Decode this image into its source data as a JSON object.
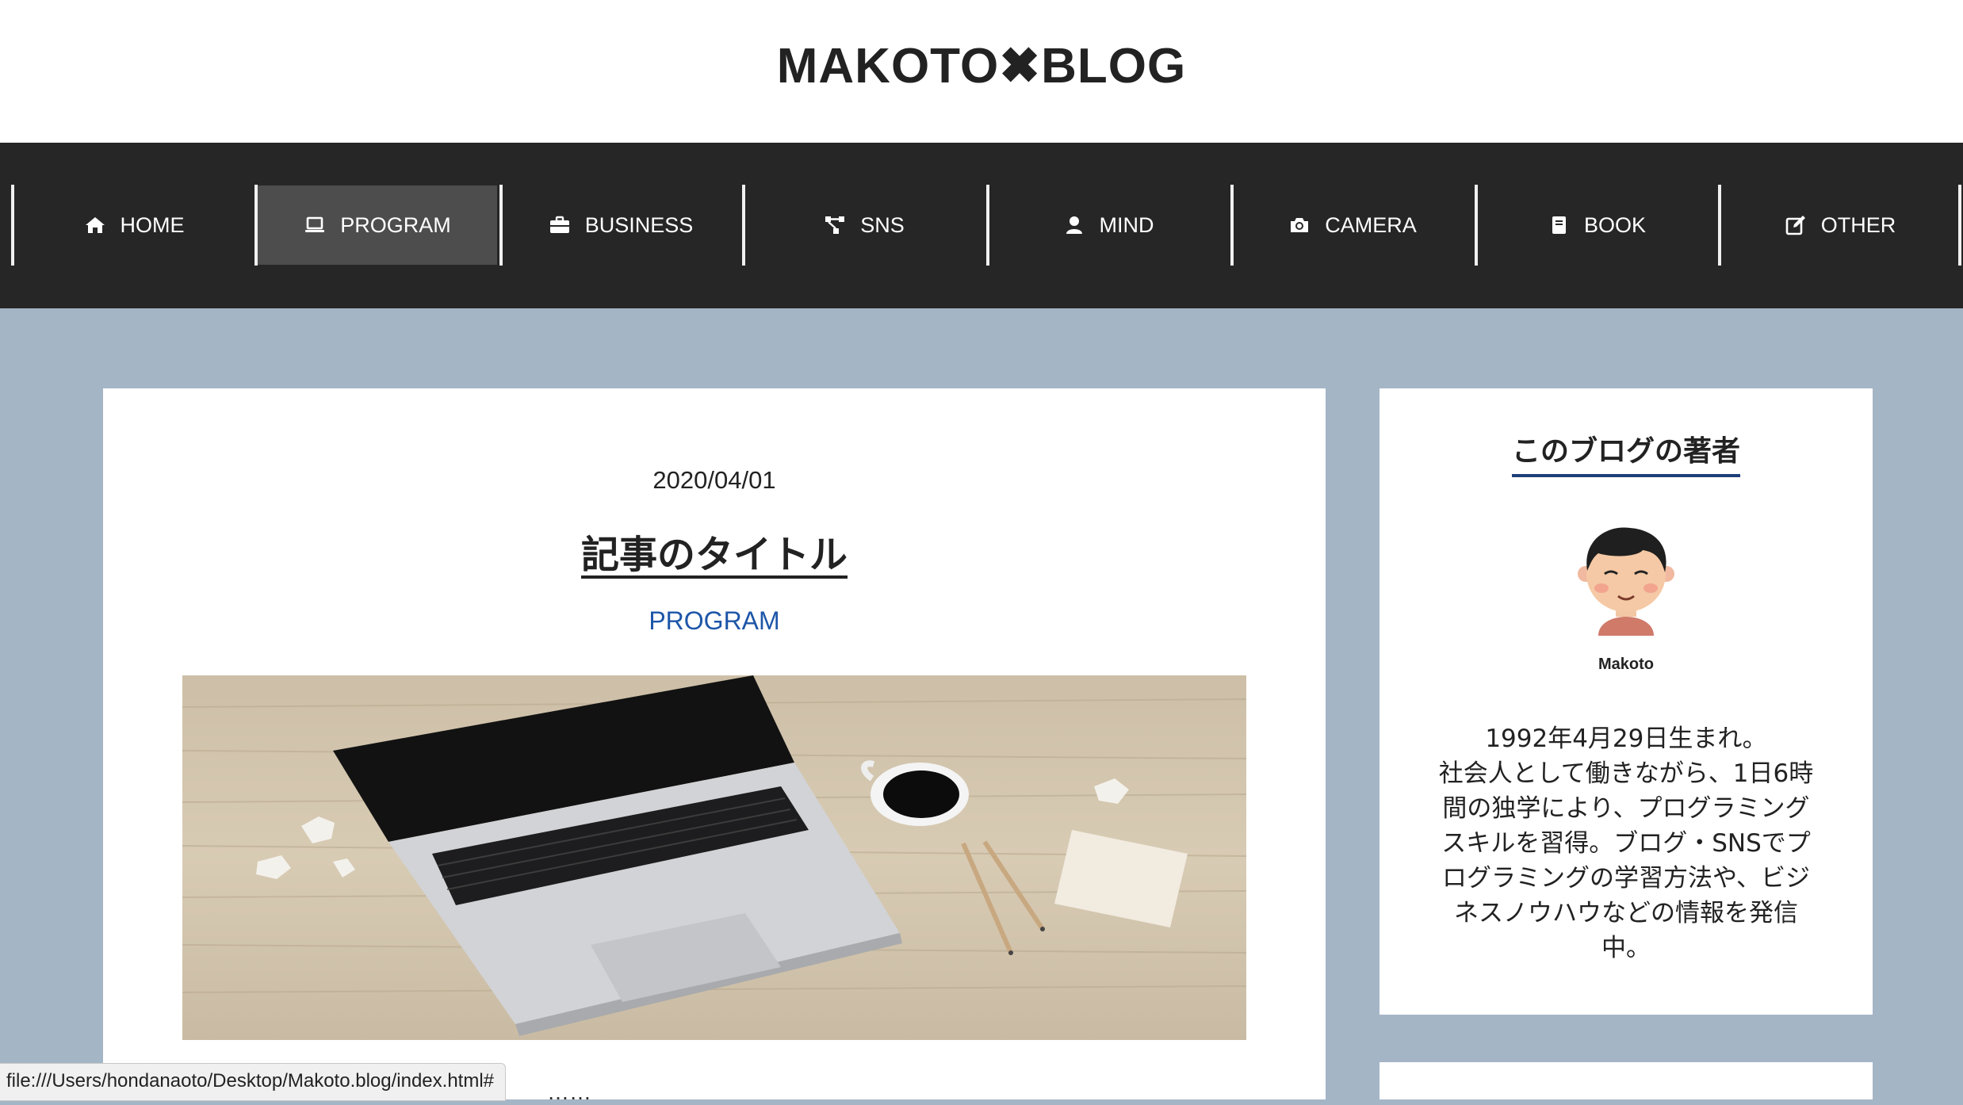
{
  "site": {
    "title": "MAKOTO✖BLOG"
  },
  "nav": {
    "items": [
      {
        "label": "HOME",
        "icon": "home-icon"
      },
      {
        "label": "PROGRAM",
        "icon": "laptop-icon",
        "active": true
      },
      {
        "label": "BUSINESS",
        "icon": "briefcase-icon"
      },
      {
        "label": "SNS",
        "icon": "network-icon"
      },
      {
        "label": "MIND",
        "icon": "user-icon"
      },
      {
        "label": "CAMERA",
        "icon": "camera-icon"
      },
      {
        "label": "BOOK",
        "icon": "book-icon"
      },
      {
        "label": "OTHER",
        "icon": "edit-icon"
      }
    ]
  },
  "post": {
    "date": "2020/04/01",
    "title": "記事のタイトル",
    "category": "PROGRAM",
    "image_alt": "laptop-on-wooden-desk",
    "excerpt_partial": "……"
  },
  "sidebar": {
    "title": "このブログの著者",
    "author_name": "Makoto",
    "bio_lines": [
      "1992年4月29日生まれ。",
      "社会人として働きながら、1日6時",
      "間の独学により、プログラミング",
      "スキルを習得。ブログ・SNSでプ",
      "ログラミングの学習方法や、ビジ",
      "ネスノウハウなどの情報を発信",
      "中。"
    ]
  },
  "status_bar": {
    "url": "file:///Users/hondanaoto/Desktop/Makoto.blog/index.html#"
  },
  "colors": {
    "background": "#a4b5c6",
    "nav_bg": "#262626",
    "nav_active": "#4d4d4d",
    "category_link": "#1d56a8",
    "title_underline": "#1d3f7a"
  }
}
